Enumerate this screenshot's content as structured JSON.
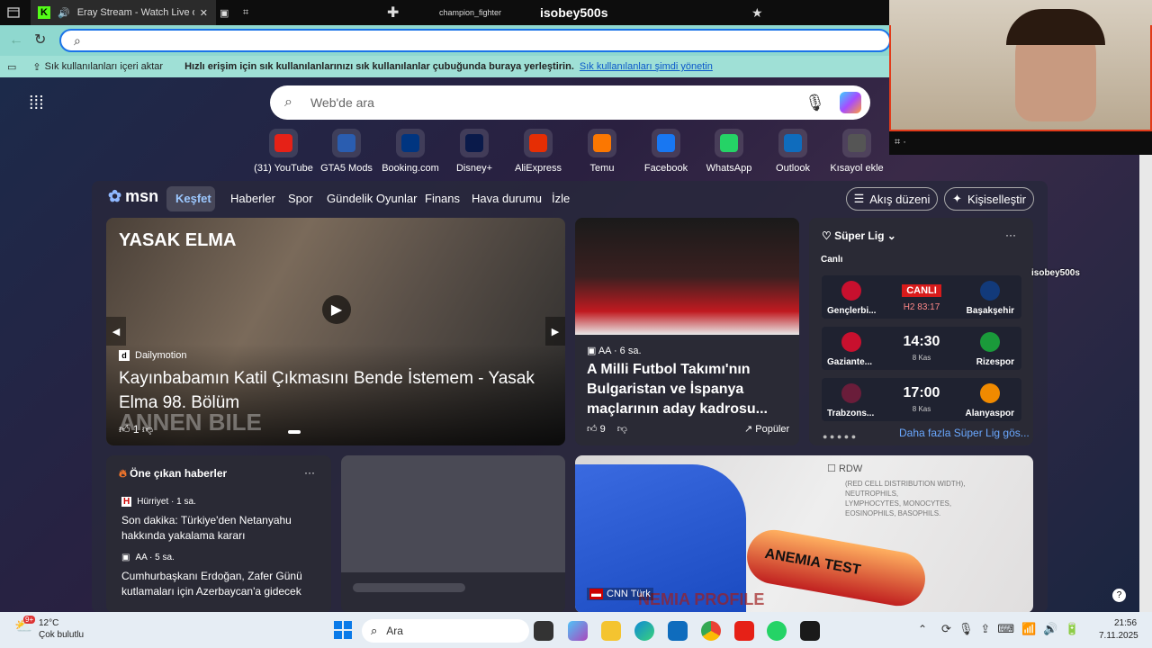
{
  "browser": {
    "tab_title": "Eray Stream - Watch Live on",
    "tab2_label": "champion_fighter",
    "stream_name": "isobey500s",
    "stream_overlay": "isobey500s",
    "favbar_import": "Sık kullanılanları içeri aktar",
    "favbar_hint": "Hızlı erişim için sık kullanılanlarınızı sık kullanılanlar çubuğunda buraya yerleştirin.",
    "favbar_link": "Sık kullanılanları şimdi yönetin"
  },
  "search": {
    "placeholder": "Web'de ara"
  },
  "shortcuts": [
    {
      "label": "(31) YouTube",
      "icon": "youtube-icon",
      "color": "#e62117"
    },
    {
      "label": "GTA5 Mods",
      "icon": "gta5mods-icon",
      "color": "#2a5db0"
    },
    {
      "label": "Booking.com",
      "icon": "booking-icon",
      "color": "#003580"
    },
    {
      "label": "Disney+",
      "icon": "disney-icon",
      "color": "#0a1a4a"
    },
    {
      "label": "AliExpress",
      "icon": "aliexpress-icon",
      "color": "#e62e04"
    },
    {
      "label": "Temu",
      "icon": "temu-icon",
      "color": "#fb7701"
    },
    {
      "label": "Facebook",
      "icon": "facebook-icon",
      "color": "#1877f2"
    },
    {
      "label": "WhatsApp",
      "icon": "whatsapp-icon",
      "color": "#25d366"
    },
    {
      "label": "Outlook",
      "icon": "outlook-icon",
      "color": "#0f6cbd"
    },
    {
      "label": "Kısayol ekle",
      "icon": "plus-icon",
      "color": "#555555"
    }
  ],
  "msn": {
    "logo": "msn",
    "nav": [
      "Keşfet",
      "Haberler",
      "Spor",
      "Gündelik Oyunlar",
      "Finans",
      "Hava durumu",
      "İzle"
    ],
    "flow_btn": "Akış düzeni",
    "personalize_btn": "Kişiselleştir"
  },
  "hero": {
    "overlay_title": "YASAK ELMA",
    "source": "Dailymotion",
    "title": "Kayınbabamın Katil Çıkmasını Bende İstemem - Yasak Elma 98. Bölüm",
    "likes": "1",
    "bottom_overlay": "ANNEN BILE"
  },
  "news2": {
    "source": "AA · 6 sa.",
    "title": "A Milli Futbol Takımı'nın Bulgaristan ve İspanya maçlarının aday kadrosu...",
    "likes": "9",
    "tag": "Popüler"
  },
  "sport": {
    "league": "Süper Lig",
    "live_label": "Canlı",
    "matches": [
      {
        "home": "Gençlerbi...",
        "away": "Başakşehir",
        "status": "CANLI",
        "detail": "H2 83:17",
        "home_color": "#c8102e",
        "away_color": "#123a7a"
      },
      {
        "home": "Gaziante...",
        "away": "Rizespor",
        "status": "14:30",
        "detail": "8 Kas",
        "home_color": "#c8102e",
        "away_color": "#1a9a3a"
      },
      {
        "home": "Trabzons...",
        "away": "Alanyaspor",
        "status": "17:00",
        "detail": "8 Kas",
        "home_color": "#6a1d3a",
        "away_color": "#f08a00"
      }
    ],
    "more": "Daha fazla Süper Lig gös..."
  },
  "featured": {
    "title": "Öne çıkan haberler",
    "items": [
      {
        "source": "Hürriyet · 1 sa.",
        "title": "Son dakika: Türkiye'den Netanyahu hakkında yakalama kararı"
      },
      {
        "source": "AA · 5 sa.",
        "title": "Cumhurbaşkanı Erdoğan, Zafer Günü kutlamaları için Azerbaycan'a gidecek"
      }
    ]
  },
  "anemia": {
    "source": "CNN Türk",
    "tube_label": "ANEMIA TEST",
    "bg_text": "NEMIA PROFILE",
    "form_label": "RDW",
    "form_lines": [
      "(RED CELL DISTRIBUTION WIDTH),",
      "NEUTROPHILS,",
      "LYMPHOCYTES, MONOCYTES,",
      "EOSINOPHILS, BASOPHILS."
    ]
  },
  "taskbar": {
    "temp": "12°C",
    "weather": "Çok bulutlu",
    "badge": "9+",
    "search": "Ara",
    "time": "21:56",
    "date": "7.11.2025"
  }
}
